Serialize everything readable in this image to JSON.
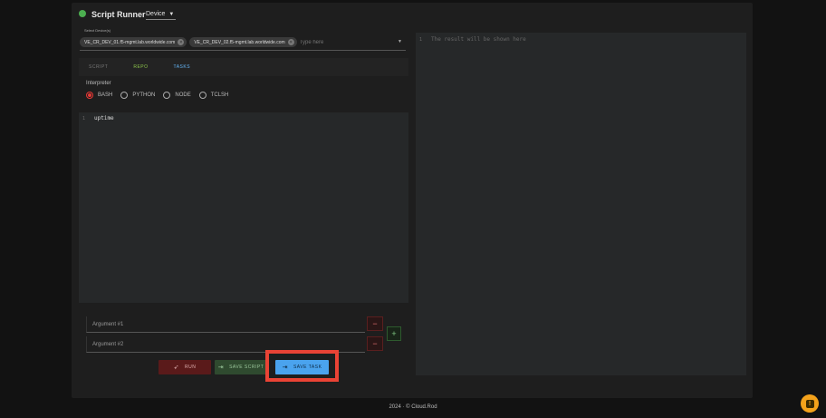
{
  "header": {
    "title": "Script Runner",
    "mode_selected": "Device",
    "status_color": "#4caf50"
  },
  "devices": {
    "label": "Select Device(s)",
    "chips": [
      "VE_CR_DEV_01.f5-mgmt.lab.worldwide.com",
      "VE_CR_DEV_02.f5-mgmt.lab.worldwide.com"
    ],
    "placeholder": "Type here"
  },
  "tabs": [
    "SCRIPT",
    "REPO",
    "TASKS"
  ],
  "interpreter": {
    "label": "Interpreter",
    "options": [
      "BASH",
      "PYTHON",
      "NODE",
      "TCLSH"
    ],
    "selected": "BASH"
  },
  "editor": {
    "line_number": "1",
    "code": "uptime"
  },
  "result": {
    "line_number": "1",
    "placeholder": "The result will be shown here"
  },
  "arguments": {
    "arg1_placeholder": "Argument #1",
    "arg2_placeholder": "Argument #2",
    "remove_label": "−",
    "add_label": "+"
  },
  "actions": {
    "run": "RUN",
    "save_script": "SAVE SCRIPT",
    "save_task": "SAVE TASK"
  },
  "footer": {
    "text": "2024 · © Cloud.Rod"
  },
  "colors": {
    "accent_red": "#e53935",
    "save_task": "#4aa3ee",
    "highlight": "#ea4335",
    "help": "#f3a21b"
  }
}
